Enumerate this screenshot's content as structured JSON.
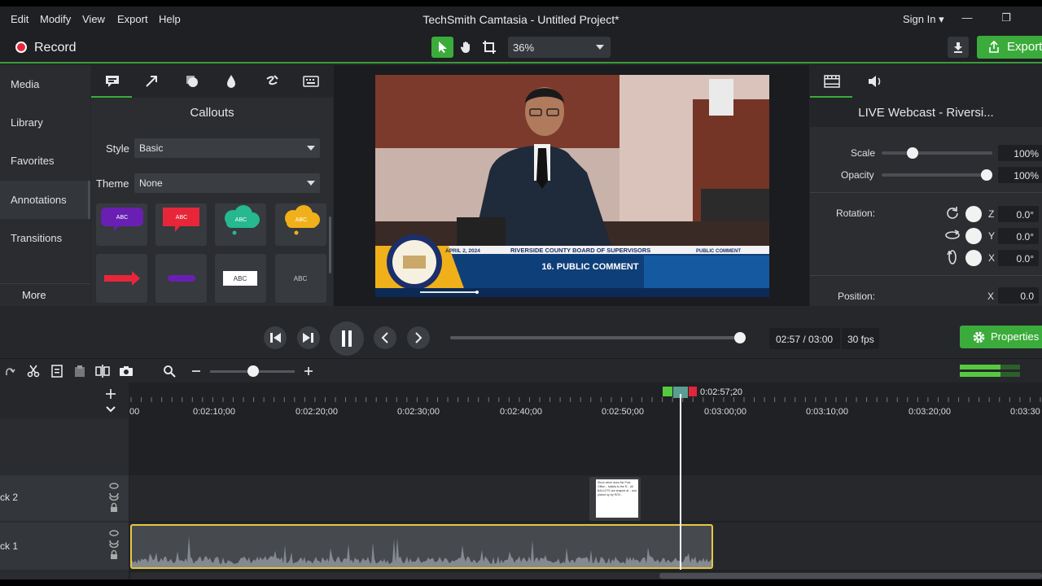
{
  "menubar": {
    "items": [
      "Edit",
      "Modify",
      "View",
      "Export",
      "Help"
    ],
    "title": "TechSmith Camtasia - Untitled Project*",
    "signin": "Sign In ▾"
  },
  "toolbar": {
    "record_label": "Record",
    "zoom": "36%",
    "export_label": "Export"
  },
  "leftnav": {
    "items": [
      "Media",
      "Library",
      "Favorites",
      "Annotations",
      "Transitions"
    ],
    "more_label": "More"
  },
  "callouts": {
    "title": "Callouts",
    "style_label": "Style",
    "style_value": "Basic",
    "theme_label": "Theme",
    "theme_value": "None",
    "tile_text": "ABC"
  },
  "video": {
    "date": "APRIL 2, 2024",
    "banner_title": "RIVERSIDE COUNTY BOARD OF SUPERVISORS",
    "banner_right": "PUBLIC COMMENT",
    "banner_main": "16. PUBLIC COMMENT",
    "seal_text": "BOARD OF SUPERVISORS"
  },
  "props": {
    "title": "LIVE Webcast - Riversi...",
    "scale_label": "Scale",
    "scale_value": "100%",
    "opacity_label": "Opacity",
    "opacity_value": "100%",
    "rotation_label": "Rotation:",
    "rot_z_label": "Z",
    "rot_z": "0.0°",
    "rot_y_label": "Y",
    "rot_y": "0.0°",
    "rot_x_label": "X",
    "rot_x": "0.0°",
    "position_label": "Position:",
    "pos_x_label": "X",
    "pos_x": "0.0",
    "scale_level": 0.25,
    "opacity_level": 1.0
  },
  "playback": {
    "time": "02:57 / 03:00",
    "fps": "30 fps",
    "properties_label": "Properties",
    "progress": 0.983
  },
  "timeline": {
    "playhead_time": "0:02:57;20",
    "ruler_labels": [
      "00",
      "0:02:10;00",
      "0:02:20;00",
      "0:02:30;00",
      "0:02:40;00",
      "0:02:50;00",
      "0:03:00;00",
      "0:03:10;00",
      "0:03:20;00",
      "0:03:30"
    ],
    "tracks": [
      {
        "name": "ck 2"
      },
      {
        "name": "ck 1"
      }
    ],
    "callout_clip_text": "Since when does the Post Office... ballots to the R... All BALLOTS are shaped at... and picked up by ROV..."
  },
  "colors": {
    "accent": "#3bab3b",
    "record": "#e8263a",
    "clip_border": "#e8c545"
  }
}
